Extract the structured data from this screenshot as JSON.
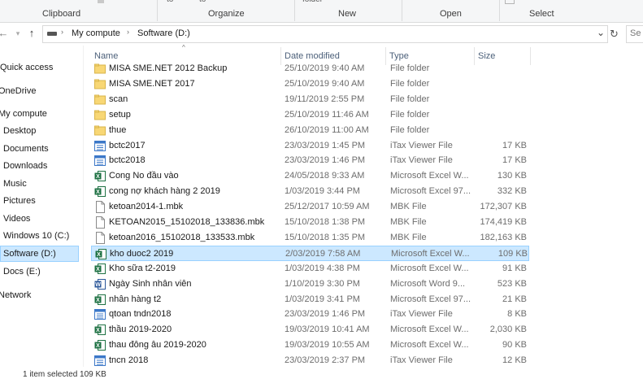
{
  "ribbon": {
    "groups": [
      "Clipboard",
      "Organize",
      "New",
      "Open",
      "Select"
    ],
    "cut_top_text": [
      "to",
      "to",
      "folder"
    ]
  },
  "nav": {
    "back": "←",
    "forward": "→",
    "up": "↑",
    "breadcrumb": [
      "My compute",
      "Software (D:)"
    ],
    "refresh": "↻",
    "search_placeholder": "Se"
  },
  "sidebar": {
    "items": [
      {
        "label": "Quick access"
      },
      {
        "label": "OneDrive"
      },
      {
        "label": "My compute"
      },
      {
        "label": "Desktop"
      },
      {
        "label": "Documents"
      },
      {
        "label": "Downloads"
      },
      {
        "label": "Music"
      },
      {
        "label": "Pictures"
      },
      {
        "label": "Videos"
      },
      {
        "label": "Windows 10 (C:)"
      },
      {
        "label": "Software (D:)"
      },
      {
        "label": "Docs (E:)"
      },
      {
        "label": "Network"
      }
    ]
  },
  "columns": {
    "name": "Name",
    "date": "Date modified",
    "type": "Type",
    "size": "Size"
  },
  "files": [
    {
      "name": "MISA SME.NET 2012 Backup",
      "date": "25/10/2019 9:40 AM",
      "type": "File folder",
      "size": "",
      "icon": "folder"
    },
    {
      "name": "MISA SME.NET 2017",
      "date": "25/10/2019 9:40 AM",
      "type": "File folder",
      "size": "",
      "icon": "folder"
    },
    {
      "name": "scan",
      "date": "19/11/2019 2:55 PM",
      "type": "File folder",
      "size": "",
      "icon": "folder"
    },
    {
      "name": "setup",
      "date": "25/10/2019 11:46 AM",
      "type": "File folder",
      "size": "",
      "icon": "folder"
    },
    {
      "name": "thue",
      "date": "26/10/2019 11:00 AM",
      "type": "File folder",
      "size": "",
      "icon": "folder"
    },
    {
      "name": "bctc2017",
      "date": "23/03/2019 1:45 PM",
      "type": "iTax Viewer File",
      "size": "17 KB",
      "icon": "itax"
    },
    {
      "name": "bctc2018",
      "date": "23/03/2019 1:46 PM",
      "type": "iTax Viewer File",
      "size": "17 KB",
      "icon": "itax"
    },
    {
      "name": "Cong No đầu vào",
      "date": "24/05/2018 9:33 AM",
      "type": "Microsoft Excel W...",
      "size": "130 KB",
      "icon": "excel"
    },
    {
      "name": "cong nợ khách hàng 2 2019",
      "date": "1/03/2019 3:44 PM",
      "type": "Microsoft Excel 97...",
      "size": "332 KB",
      "icon": "excel"
    },
    {
      "name": "ketoan2014-1.mbk",
      "date": "25/12/2017 10:59 AM",
      "type": "MBK File",
      "size": "172,307 KB",
      "icon": "file"
    },
    {
      "name": "KETOAN2015_15102018_133836.mbk",
      "date": "15/10/2018 1:38 PM",
      "type": "MBK File",
      "size": "174,419 KB",
      "icon": "file"
    },
    {
      "name": "ketoan2016_15102018_133533.mbk",
      "date": "15/10/2018 1:35 PM",
      "type": "MBK File",
      "size": "182,163 KB",
      "icon": "file"
    },
    {
      "name": "kho duoc2 2019",
      "date": "2/03/2019 7:58 AM",
      "type": "Microsoft Excel W...",
      "size": "109 KB",
      "icon": "excel"
    },
    {
      "name": "Kho sữa t2-2019",
      "date": "1/03/2019 4:38 PM",
      "type": "Microsoft Excel W...",
      "size": "91 KB",
      "icon": "excel"
    },
    {
      "name": "Ngày Sinh nhân viên",
      "date": "1/10/2019 3:30 PM",
      "type": "Microsoft Word 9...",
      "size": "523 KB",
      "icon": "word"
    },
    {
      "name": "nhân hàng t2",
      "date": "1/03/2019 3:41 PM",
      "type": "Microsoft Excel 97...",
      "size": "21 KB",
      "icon": "excel"
    },
    {
      "name": "qtoan tndn2018",
      "date": "23/03/2019 1:46 PM",
      "type": "iTax Viewer File",
      "size": "8 KB",
      "icon": "itax"
    },
    {
      "name": "thầu 2019-2020",
      "date": "19/03/2019 10:41 AM",
      "type": "Microsoft Excel W...",
      "size": "2,030 KB",
      "icon": "excel"
    },
    {
      "name": "thau đông âu 2019-2020",
      "date": "19/03/2019 10:55 AM",
      "type": "Microsoft Excel W...",
      "size": "90 KB",
      "icon": "excel"
    },
    {
      "name": "tncn 2018",
      "date": "23/03/2019 2:37 PM",
      "type": "iTax Viewer File",
      "size": "12 KB",
      "icon": "itax"
    }
  ],
  "selected_file_index": 12,
  "status": {
    "text": "1 item selected  109 KB"
  },
  "colors": {
    "selection": "#cce8ff",
    "selection_border": "#99d1ff",
    "folder": "#f8d775",
    "excel": "#1f7244",
    "word": "#2b579a",
    "itax": "#3c78c8"
  }
}
